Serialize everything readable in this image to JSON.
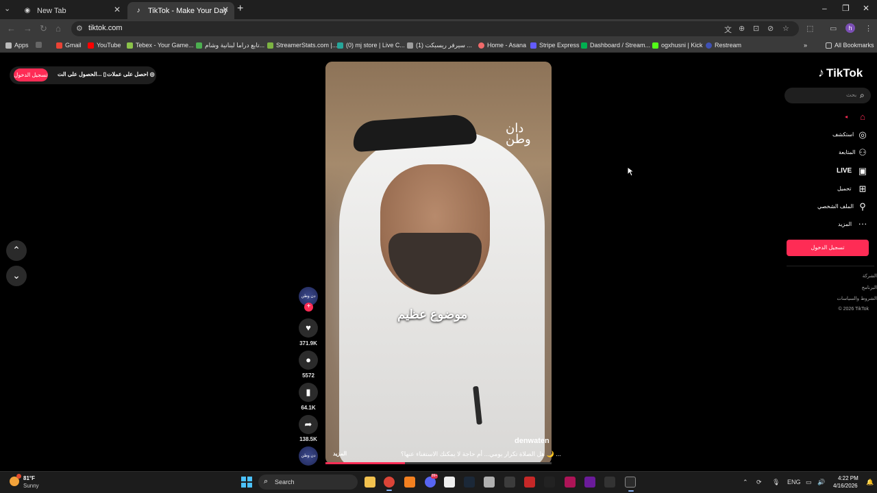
{
  "browser": {
    "tabs": [
      {
        "label": "New Tab",
        "active": false
      },
      {
        "label": "TikTok - Make Your Day",
        "active": true
      }
    ],
    "url": "tiktok.com",
    "profile_initial": "h",
    "bookmarks": [
      {
        "label": "Apps",
        "color": "#e94235"
      },
      {
        "label": "Gmail",
        "color": "#ea4335"
      },
      {
        "label": "YouTube",
        "color": "#ff0000"
      },
      {
        "label": "Tebex - Your Game...",
        "color": "#8bc34a"
      },
      {
        "label": "تابع دراما لبنانية وشام...",
        "color": "#4caf50"
      },
      {
        "label": "StreamerStats.com |...",
        "color": "#7cb342"
      },
      {
        "label": "(0) mj store | Live C...",
        "color": "#26a69a"
      },
      {
        "label": "(1) سيرفر ريسبكت ...",
        "color": "#9e9e9e"
      },
      {
        "label": "Home - Asana",
        "color": "#f06a6a"
      },
      {
        "label": "Stripe Express",
        "color": "#635bff"
      },
      {
        "label": "Dashboard / Stream...",
        "color": "#00b050"
      },
      {
        "label": "ogxhusni | Kick",
        "color": "#53fc18"
      },
      {
        "label": "Restream",
        "color": "#3f51b5"
      }
    ],
    "all_bookmarks": "All Bookmarks"
  },
  "top_buttons": {
    "login": "تسجيل الدخول",
    "get_app": "الحصول على الت...",
    "get_coins": "احصل على عملات"
  },
  "video": {
    "overlay_text": "موضوع عظيم",
    "brand_mark_line1": "دان",
    "brand_mark_line2": "وطن",
    "author": "denwaten",
    "caption": "هل الصلاة تكرار يومي... أم حاجة لا يمكنك الاستغناء عنها؟ 🌙 ...",
    "more": "المزيد",
    "progress_fraction": 0.35
  },
  "actions": {
    "avatar_label": "دن وطن",
    "likes": "371.9K",
    "comments": "5572",
    "saves": "64.1K",
    "shares": "138.5K"
  },
  "sidebar": {
    "logo": "TikTok",
    "search_placeholder": "بحث",
    "items": [
      {
        "label": "",
        "icon": "home-icon"
      },
      {
        "label": "استكشف",
        "icon": "compass-icon"
      },
      {
        "label": "المتابعة",
        "icon": "following-icon"
      },
      {
        "label": "LIVE",
        "icon": "live-icon"
      },
      {
        "label": "تحميل",
        "icon": "upload-icon"
      },
      {
        "label": "الملف الشخصي",
        "icon": "profile-icon"
      },
      {
        "label": "المزيد",
        "icon": "more-icon"
      }
    ],
    "login_button": "تسجيل الدخول",
    "footer": [
      "الشركة",
      "البرنامج",
      "الشروط والسياسات",
      "© 2026 TikTok"
    ]
  },
  "taskbar": {
    "temperature": "81°F",
    "condition": "Sunny",
    "search": "Search",
    "badge": "99+",
    "language": "ENG",
    "time": "4:22 PM",
    "date": "4/16/2026"
  }
}
